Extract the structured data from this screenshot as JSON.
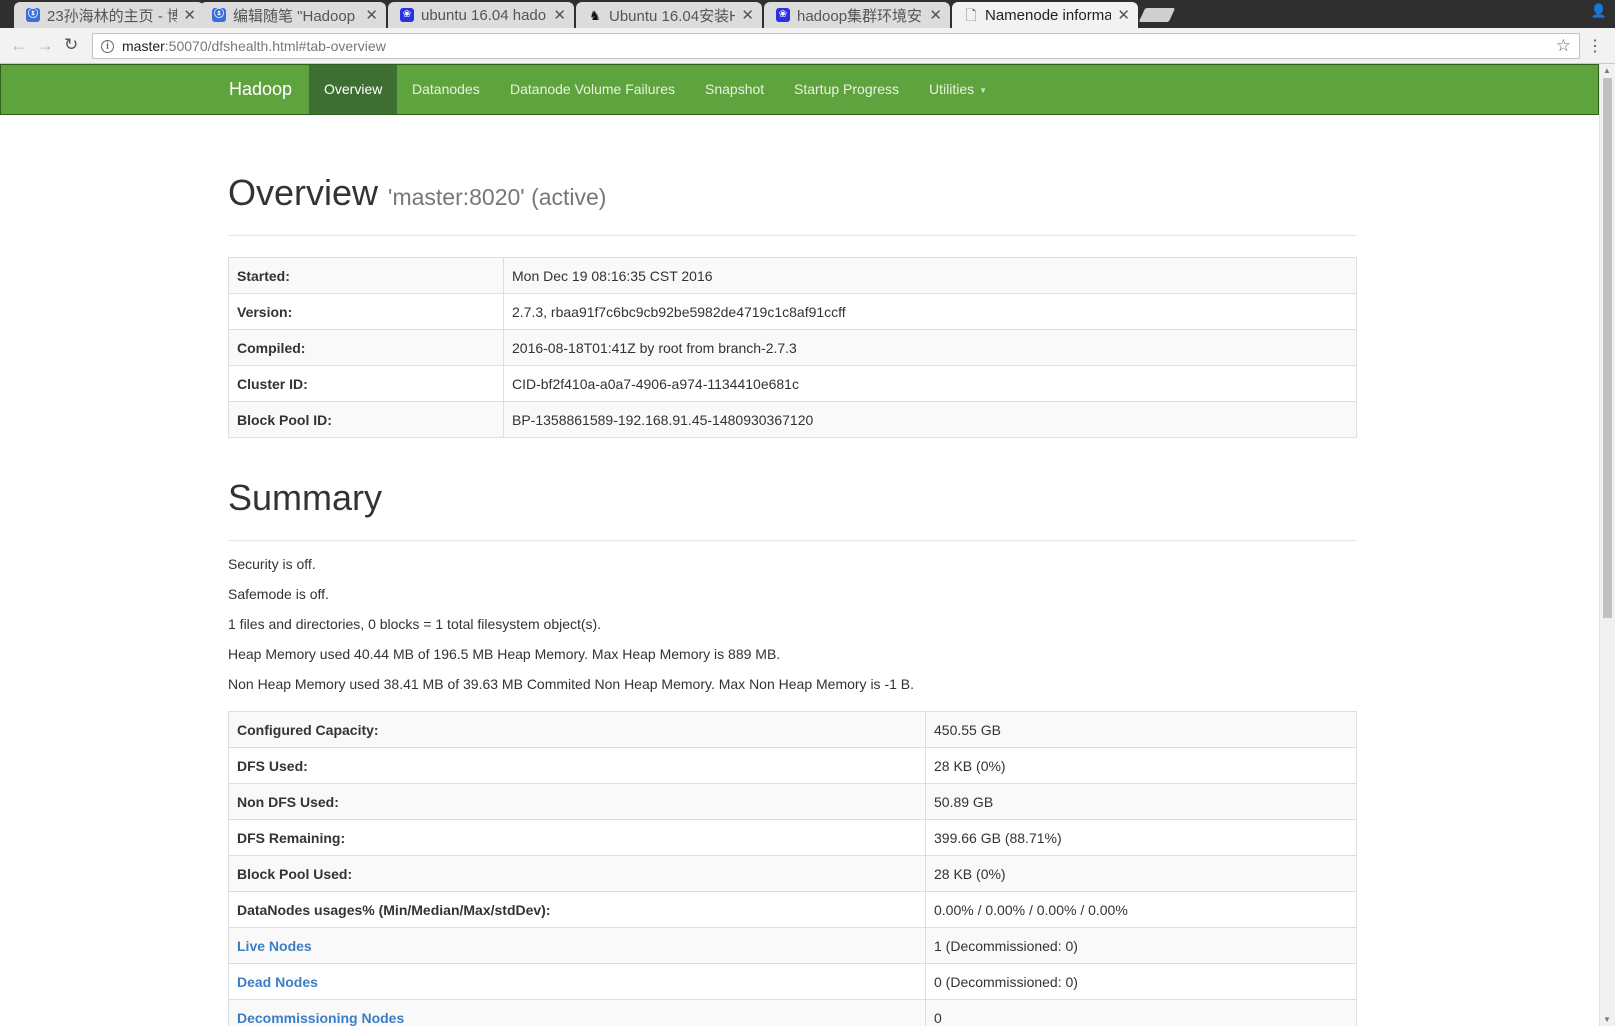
{
  "browser": {
    "tabs": [
      {
        "title": "23孙海林的主页 - 博",
        "icon": "blog-icon"
      },
      {
        "title": "编辑随笔 \"Hadoop",
        "icon": "blog-icon"
      },
      {
        "title": "ubuntu 16.04 hado",
        "icon": "paw-icon"
      },
      {
        "title": "Ubuntu 16.04安装H",
        "icon": "tux-icon"
      },
      {
        "title": "hadoop集群环境安",
        "icon": "paw-icon"
      },
      {
        "title": "Namenode informa",
        "icon": "document-icon"
      }
    ],
    "url_host": "master",
    "url_rest": ":50070/dfshealth.html#tab-overview"
  },
  "navbar": {
    "brand": "Hadoop",
    "items": [
      "Overview",
      "Datanodes",
      "Datanode Volume Failures",
      "Snapshot",
      "Startup Progress",
      "Utilities"
    ],
    "active": "Overview",
    "color": "#5fa33e"
  },
  "overview": {
    "title": "Overview",
    "subtitle": "'master:8020' (active)",
    "rows": [
      {
        "label": "Started:",
        "value": "Mon Dec 19 08:16:35 CST 2016"
      },
      {
        "label": "Version:",
        "value": "2.7.3, rbaa91f7c6bc9cb92be5982de4719c1c8af91ccff"
      },
      {
        "label": "Compiled:",
        "value": "2016-08-18T01:41Z by root from branch-2.7.3"
      },
      {
        "label": "Cluster ID:",
        "value": "CID-bf2f410a-a0a7-4906-a974-1134410e681c"
      },
      {
        "label": "Block Pool ID:",
        "value": "BP-1358861589-192.168.91.45-1480930367120"
      }
    ]
  },
  "summary": {
    "title": "Summary",
    "lines": [
      "Security is off.",
      "Safemode is off.",
      "1 files and directories, 0 blocks = 1 total filesystem object(s).",
      "Heap Memory used 40.44 MB of 196.5 MB Heap Memory. Max Heap Memory is 889 MB.",
      "Non Heap Memory used 38.41 MB of 39.63 MB Commited Non Heap Memory. Max Non Heap Memory is -1 B."
    ],
    "rows": [
      {
        "label": "Configured Capacity:",
        "value": "450.55 GB"
      },
      {
        "label": "DFS Used:",
        "value": "28 KB (0%)"
      },
      {
        "label": "Non DFS Used:",
        "value": "50.89 GB"
      },
      {
        "label": "DFS Remaining:",
        "value": "399.66 GB (88.71%)"
      },
      {
        "label": "Block Pool Used:",
        "value": "28 KB (0%)"
      },
      {
        "label": "DataNodes usages% (Min/Median/Max/stdDev):",
        "value": "0.00% / 0.00% / 0.00% / 0.00%"
      },
      {
        "label": "Live Nodes",
        "value": "1 (Decommissioned: 0)"
      },
      {
        "label": "Dead Nodes",
        "value": "0 (Decommissioned: 0)"
      },
      {
        "label": "Decommissioning Nodes",
        "value": "0"
      }
    ]
  }
}
